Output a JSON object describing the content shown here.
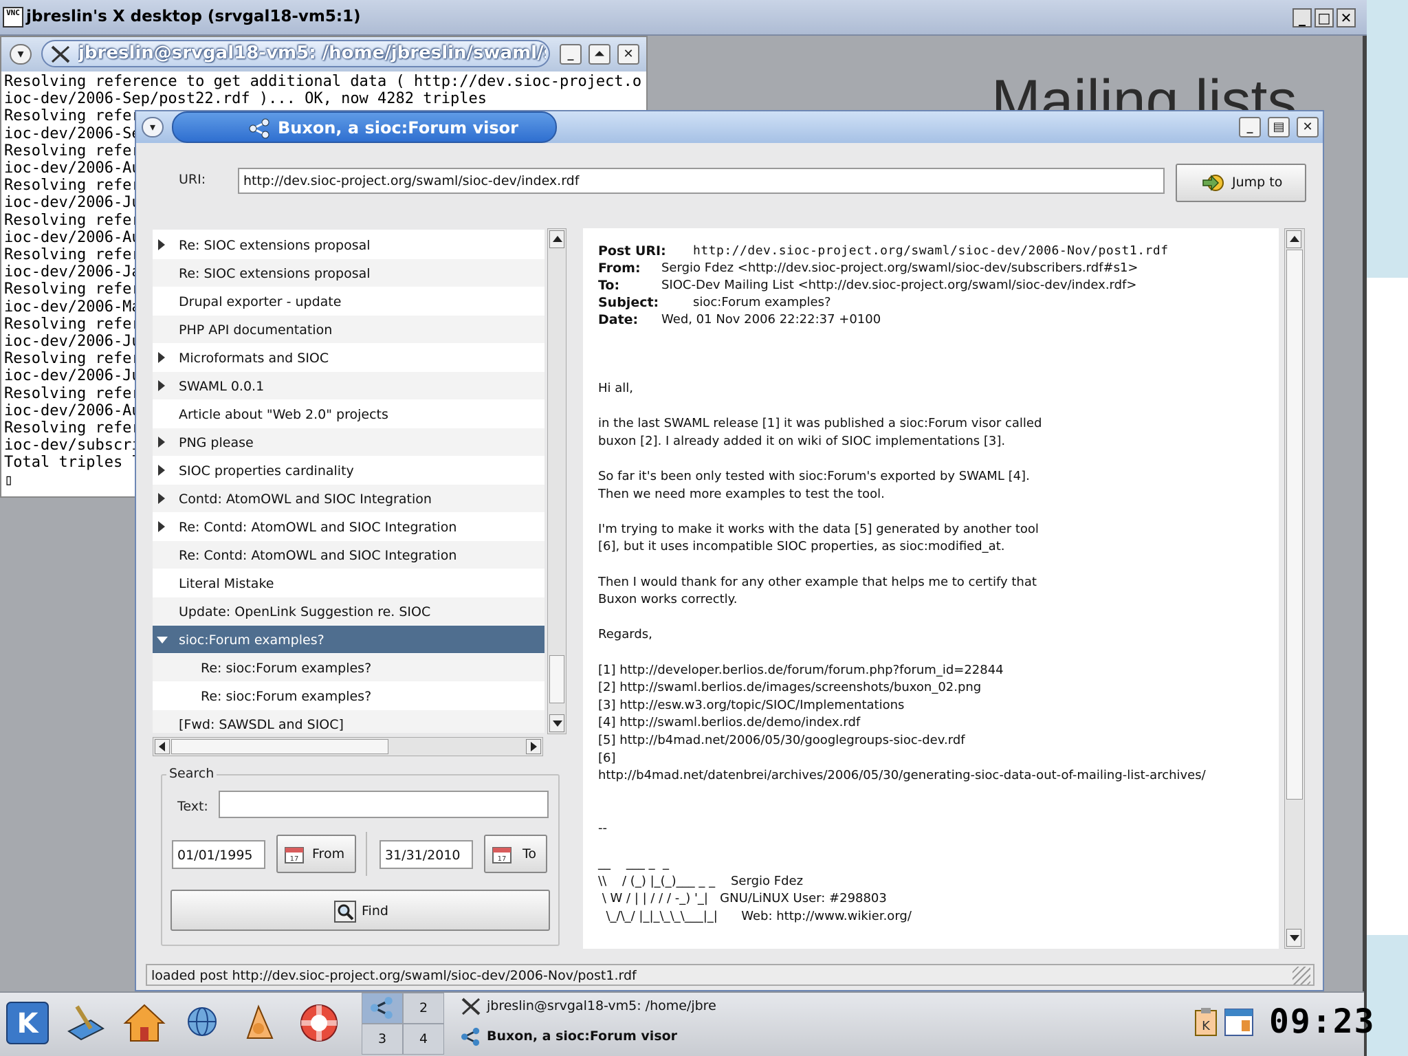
{
  "vnc": {
    "logo_text": "VNC",
    "title": "jbreslin's X desktop (srvgal18-vm5:1)",
    "controls": [
      "_",
      "□",
      "✕"
    ]
  },
  "terminal": {
    "title": "jbreslin@srvgal18-vm5: /home/jbreslin/swaml/swar",
    "lines": [
      "Resolving reference to get additional data ( http://dev.sioc-project.org/swaml/s",
      "ioc-dev/2006-Sep/post22.rdf )... OK, now 4282 triples",
      "Resolving refer",
      "ioc-dev/2006-Sep",
      "Resolving refere",
      "ioc-dev/2006-Aug",
      "Resolving refere",
      "ioc-dev/2006-Jul",
      "Resolving refere",
      "ioc-dev/2006-Aug",
      "Resolving refere",
      "ioc-dev/2006-Jan",
      "Resolving refere",
      "ioc-dev/2006-May",
      "Resolving refere",
      "ioc-dev/2006-Jul",
      "Resolving refere",
      "ioc-dev/2006-Jun",
      "Resolving refere",
      "ioc-dev/2006-Aug",
      "Resolving refere",
      "ioc-dev/subscrib",
      "Total triples lo",
      "▯"
    ]
  },
  "slide": {
    "title": "Mailing lists"
  },
  "buxon": {
    "title": "Buxon, a sioc:Forum visor",
    "uri_label": "URI:",
    "uri_value": "http://dev.sioc-project.org/swaml/sioc-dev/index.rdf",
    "jump_label": "Jump to",
    "threads": [
      {
        "label": "Re: SIOC extensions proposal",
        "expander": "closed",
        "indent": 0
      },
      {
        "label": "Re: SIOC extensions proposal",
        "expander": "none",
        "indent": 0
      },
      {
        "label": "Drupal exporter - update",
        "expander": "none",
        "indent": 0
      },
      {
        "label": "PHP API documentation",
        "expander": "none",
        "indent": 0
      },
      {
        "label": "Microformats and SIOC",
        "expander": "closed",
        "indent": 0
      },
      {
        "label": "SWAML 0.0.1",
        "expander": "closed",
        "indent": 0
      },
      {
        "label": "Article about \"Web 2.0\" projects",
        "expander": "none",
        "indent": 0
      },
      {
        "label": "PNG please",
        "expander": "closed",
        "indent": 0
      },
      {
        "label": "SIOC properties cardinality",
        "expander": "closed",
        "indent": 0
      },
      {
        "label": "Contd: AtomOWL and SIOC Integration",
        "expander": "closed",
        "indent": 0
      },
      {
        "label": "Re: Contd: AtomOWL and SIOC Integration",
        "expander": "closed",
        "indent": 0
      },
      {
        "label": "Re: Contd: AtomOWL and SIOC Integration",
        "expander": "none",
        "indent": 0
      },
      {
        "label": "Literal Mistake",
        "expander": "none",
        "indent": 0
      },
      {
        "label": "Update: OpenLink Suggestion re. SIOC",
        "expander": "none",
        "indent": 0
      },
      {
        "label": "sioc:Forum examples?",
        "expander": "open",
        "indent": 0,
        "selected": true
      },
      {
        "label": "Re: sioc:Forum examples?",
        "expander": "none",
        "indent": 1
      },
      {
        "label": "Re: sioc:Forum examples?",
        "expander": "none",
        "indent": 1
      },
      {
        "label": "[Fwd: SAWSDL and SIOC]",
        "expander": "none",
        "indent": 0
      }
    ],
    "search": {
      "legend": "Search",
      "text_label": "Text:",
      "text_value": "",
      "from_date": "01/01/1995",
      "from_label": "From",
      "to_date": "31/31/2010",
      "to_label": "To",
      "find_label": "Find"
    },
    "message": {
      "post_uri_key": "Post URI:",
      "post_uri": "http://dev.sioc-project.org/swaml/sioc-dev/2006-Nov/post1.rdf",
      "from_key": "From:",
      "from": "Sergio Fdez <http://dev.sioc-project.org/swaml/sioc-dev/subscribers.rdf#s1>",
      "to_key": "To:",
      "to": "SIOC-Dev Mailing List <http://dev.sioc-project.org/swaml/sioc-dev/index.rdf>",
      "subject_key": "Subject:",
      "subject": "sioc:Forum examples?",
      "date_key": "Date:",
      "date": "Wed, 01 Nov 2006 22:22:37 +0100",
      "body": [
        "Hi all,",
        "",
        "in the last SWAML release [1] it was published a sioc:Forum visor called",
        "buxon [2]. I already added it on wiki of SIOC implementations [3].",
        "",
        "So far it's been only tested with sioc:Forum's exported by SWAML [4].",
        "Then we need more examples to test the tool.",
        "",
        "I'm trying to make it works with the data [5] generated by another tool",
        "[6], but it uses incompatible SIOC properties, as sioc:modified_at.",
        "",
        "Then I would thank for any other example that helps me to certify that",
        "Buxon works correctly.",
        "",
        "Regards,",
        "",
        "[1] http://developer.berlios.de/forum/forum.php?forum_id=22844",
        "[2] http://swaml.berlios.de/images/screenshots/buxon_02.png",
        "[3] http://esw.w3.org/topic/SIOC/Implementations",
        "[4] http://swaml.berlios.de/demo/index.rdf",
        "[5] http://b4mad.net/2006/05/30/googlegroups-sioc-dev.rdf",
        "[6]",
        "http://b4mad.net/datenbrei/archives/2006/05/30/generating-sioc-data-out-of-mailing-list-archives/",
        "",
        "",
        "--",
        "",
        "__    ___ _  _",
        "\\\\    / (_) |_(_)___ _ _    Sergio Fdez",
        " \\ W / | | / / / -_) '_|   GNU/LiNUX User: #298803",
        "  \\_/\\_/ |_|_\\_\\_\\___|_|      Web: http://www.wikier.org/",
        "",
        "",
        "--~--~---------~--~----~------------~-------~--~----~"
      ]
    },
    "status": "loaded post http://dev.sioc-project.org/swaml/sioc-dev/2006-Nov/post1.rdf"
  },
  "panel": {
    "icons": [
      "kde-menu-icon",
      "desktop-icon",
      "home-icon",
      "network-icon",
      "office-icon",
      "help-icon"
    ],
    "pager": [
      "1",
      "2",
      "3",
      "4"
    ],
    "tasks": [
      {
        "label": "jbreslin@srvgal18-vm5: /home/jbre",
        "active": false
      },
      {
        "label": "Buxon, a sioc:Forum visor",
        "active": true
      }
    ],
    "clock": "09:23"
  }
}
